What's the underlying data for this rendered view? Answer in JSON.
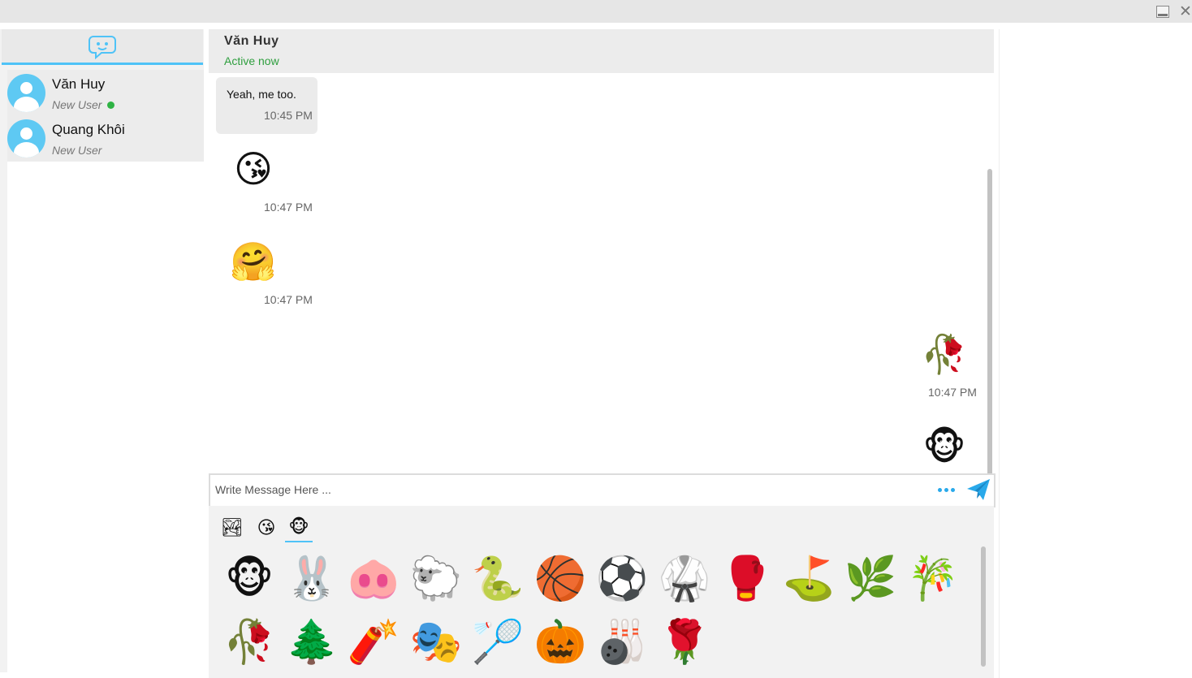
{
  "window": {
    "minimize_icon": "minimize-icon",
    "close_icon": "close-icon"
  },
  "sidebar": {
    "header_icon": "chat-bubbles-icon",
    "accent": "#4fc3f7",
    "contacts": [
      {
        "name": "Văn Huy",
        "status": "New User",
        "online": true
      },
      {
        "name": "Quang Khôi",
        "status": "New User",
        "online": false
      }
    ]
  },
  "chat": {
    "contact_name": "Văn Huy",
    "presence": "Active now",
    "presence_color": "#2e9e3e",
    "messages": [
      {
        "from": "them",
        "type": "text",
        "text": "Yeah, me too.",
        "time": "10:45 PM"
      },
      {
        "from": "them",
        "type": "emoji",
        "emoji": "😘",
        "time": "10:47 PM"
      },
      {
        "from": "them",
        "type": "emoji",
        "emoji": "🤗",
        "time": "10:47 PM"
      },
      {
        "from": "me",
        "type": "emoji",
        "emoji": "🥀",
        "time": "10:47 PM"
      },
      {
        "from": "me",
        "type": "emoji",
        "emoji": "🐵",
        "time": ""
      }
    ]
  },
  "composer": {
    "placeholder": "Write Message Here ...",
    "value": "",
    "more_icon": "more-dots-icon",
    "send_icon": "send-icon"
  },
  "picker": {
    "tabs": [
      {
        "icon": "image-icon",
        "glyph": "🏞"
      },
      {
        "icon": "emoji-icon",
        "glyph": "😘"
      },
      {
        "icon": "sticker-icon",
        "glyph": "🐵",
        "active": true
      }
    ],
    "stickers": [
      "🐵",
      "🐰",
      "🐽",
      "🐑",
      "🐍",
      "🏀",
      "⚽",
      "🥋",
      "🥊",
      "⛳",
      "🌿",
      "🎋",
      "🥀",
      "🌲",
      "🧨",
      "🎭",
      "🏸",
      "🎃",
      "🎳",
      "🌹"
    ]
  }
}
